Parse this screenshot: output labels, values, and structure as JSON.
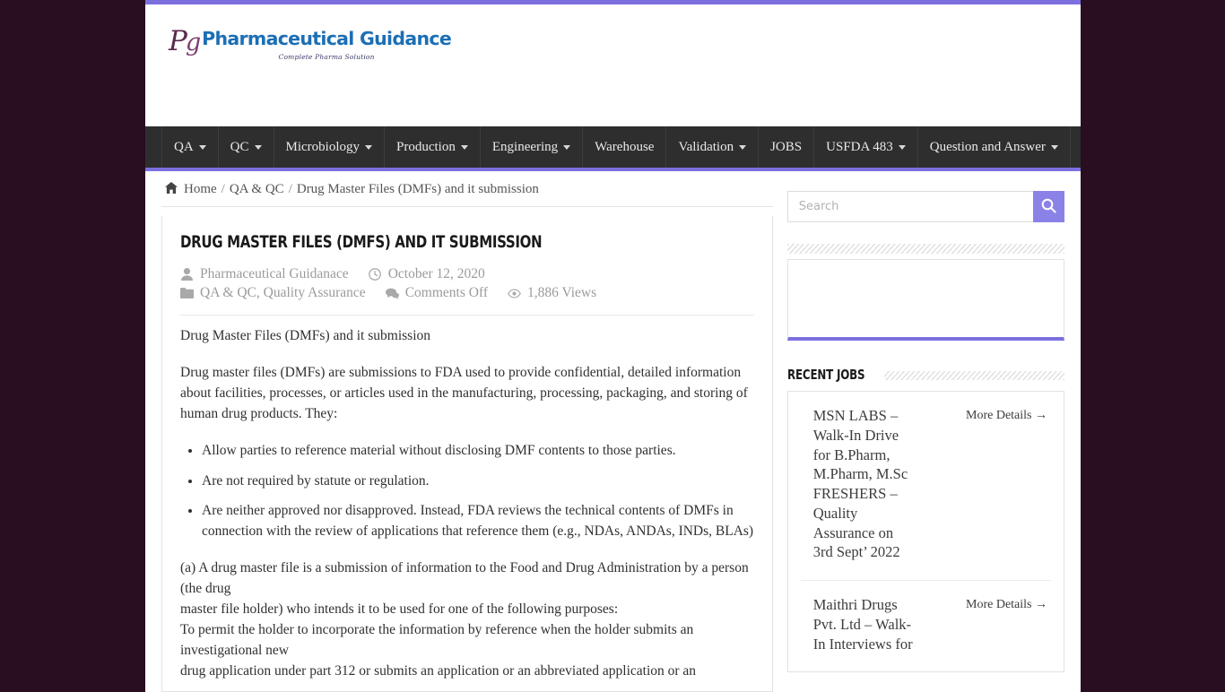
{
  "site": {
    "logo_monogram_p": "P",
    "logo_monogram_g": "g",
    "logo_title": "Pharmaceutical Guidance",
    "logo_tagline": "Complete Pharma Solution",
    "accent_color": "#7b6fe0",
    "nav_background": "#2e2e2e",
    "page_background": "#290d21"
  },
  "nav": {
    "items": [
      {
        "label": "QA",
        "has_dropdown": true
      },
      {
        "label": "QC",
        "has_dropdown": true
      },
      {
        "label": "Microbiology",
        "has_dropdown": true
      },
      {
        "label": "Production",
        "has_dropdown": true
      },
      {
        "label": "Engineering",
        "has_dropdown": true
      },
      {
        "label": "Warehouse",
        "has_dropdown": false
      },
      {
        "label": "Validation",
        "has_dropdown": true
      },
      {
        "label": "JOBS",
        "has_dropdown": false
      },
      {
        "label": "USFDA 483",
        "has_dropdown": true
      },
      {
        "label": "Question and Answer",
        "has_dropdown": true
      }
    ]
  },
  "breadcrumb": {
    "home_icon": "home-icon",
    "items": [
      "Home",
      "QA & QC",
      "Drug Master Files (DMFs) and it submission"
    ],
    "separator": "/"
  },
  "article": {
    "title": "Drug Master Files (DMFs) and it submission",
    "meta": {
      "author_icon": "user-icon",
      "author": "Pharmaceutical Guidanace",
      "date_icon": "clock-icon",
      "date": "October 12, 2020",
      "category_icon": "folder-icon",
      "categories": "QA & QC, Quality Assurance",
      "comments_icon": "comments-icon",
      "comments": "Comments Off",
      "views_icon": "eye-icon",
      "views": "1,886 Views"
    },
    "intro": "Drug Master Files (DMFs) and it submission",
    "paragraph_1": "Drug master files (DMFs) are submissions to FDA used to provide confidential, detailed information about facilities, processes, or articles used in the manufacturing, processing, packaging, and storing of human drug products. They:",
    "bullets": [
      "Allow parties to reference material without disclosing DMF contents to those parties.",
      "Are not required by statute or regulation.",
      "Are neither approved nor disapproved. Instead, FDA reviews the technical contents of DMFs in connection with the review of applications that reference them (e.g., NDAs, ANDAs, INDs, BLAs)"
    ],
    "paragraph_2_lines": [
      "(a) A drug master file is a submission of information to the Food and Drug Administration by a person (the drug",
      "master file holder) who intends it to be used for one of the following purposes:",
      "To permit the holder to incorporate the information by reference when the holder submits an investigational new",
      "drug application under part 312 or submits an application or an abbreviated application or an"
    ]
  },
  "sidebar": {
    "search": {
      "placeholder": "Search",
      "value": "",
      "button_icon": "search-icon",
      "button_color": "#8b82e8"
    },
    "recent_jobs": {
      "title": "Recent Jobs",
      "items": [
        {
          "title": "MSN LABS – Walk-In Drive for B.Pharm, M.Pharm, M.Sc FRESHERS – Quality Assurance on 3rd Sept’ 2022",
          "more_label": "More Details →"
        },
        {
          "title": "Maithri Drugs Pvt. Ltd – Walk-In Interviews for",
          "more_label": "More Details →"
        }
      ]
    }
  }
}
